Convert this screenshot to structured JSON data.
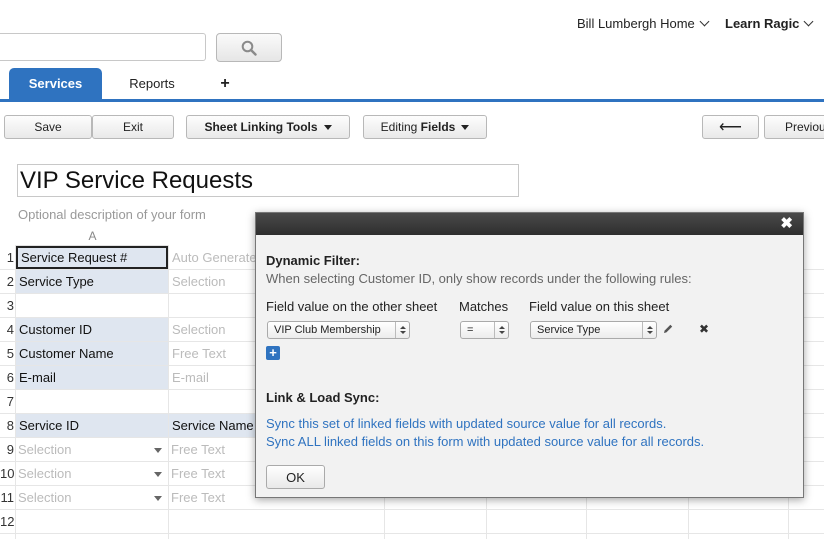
{
  "topbar": {
    "search_placeholder": "",
    "home_link": "Bill Lumbergh Home",
    "learn_link": "Learn Ragic"
  },
  "tabs": [
    {
      "label": "Services",
      "active": true
    },
    {
      "label": "Reports",
      "active": false
    },
    {
      "label": "+",
      "active": false
    }
  ],
  "toolbar": {
    "save": "Save",
    "exit": "Exit",
    "sheet_linking": "Sheet Linking Tools",
    "editing_prefix": "Editing ",
    "editing_bold": "Fields",
    "prev_arrow": "⟵",
    "previous": "Previous"
  },
  "form": {
    "title": "VIP Service Requests",
    "description": "Optional description of your form",
    "column_a": "A",
    "rows": [
      {
        "num": "1",
        "label": "Service Request #",
        "value": "Auto Generate"
      },
      {
        "num": "2",
        "label": "Service Type",
        "value": "Selection"
      },
      {
        "num": "3",
        "label": "",
        "value": ""
      },
      {
        "num": "4",
        "label": "Customer ID",
        "value": "Selection"
      },
      {
        "num": "5",
        "label": "Customer Name",
        "value": "Free Text"
      },
      {
        "num": "6",
        "label": "E-mail",
        "value": "E-mail"
      },
      {
        "num": "7",
        "label": "",
        "value": ""
      },
      {
        "num": "8",
        "label": "Service ID",
        "value": "Service Name"
      },
      {
        "num": "9",
        "label": "Selection",
        "value": "Free Text"
      },
      {
        "num": "10",
        "label": "Selection",
        "value": "Free Text"
      },
      {
        "num": "11",
        "label": "Selection",
        "value": "Free Text"
      },
      {
        "num": "12",
        "label": "",
        "value": ""
      }
    ]
  },
  "dialog": {
    "close": "✖",
    "dynamic_filter_title": "Dynamic Filter:",
    "dynamic_filter_desc": "When selecting Customer ID, only show records under the following rules:",
    "col_other_sheet": "Field value on the other sheet",
    "col_matches": "Matches",
    "col_this_sheet": "Field value on this sheet",
    "other_sheet_value": "VIP Club Membership",
    "matches_value": "=",
    "this_sheet_value": "Service Type",
    "add_rule": "+",
    "remove_rule": "✖",
    "link_load_title": "Link & Load Sync:",
    "sync_link_1": "Sync this set of linked fields with updated source value for all records.",
    "sync_link_2": "Sync ALL linked fields on this form with updated source value for all records.",
    "ok": "OK"
  }
}
